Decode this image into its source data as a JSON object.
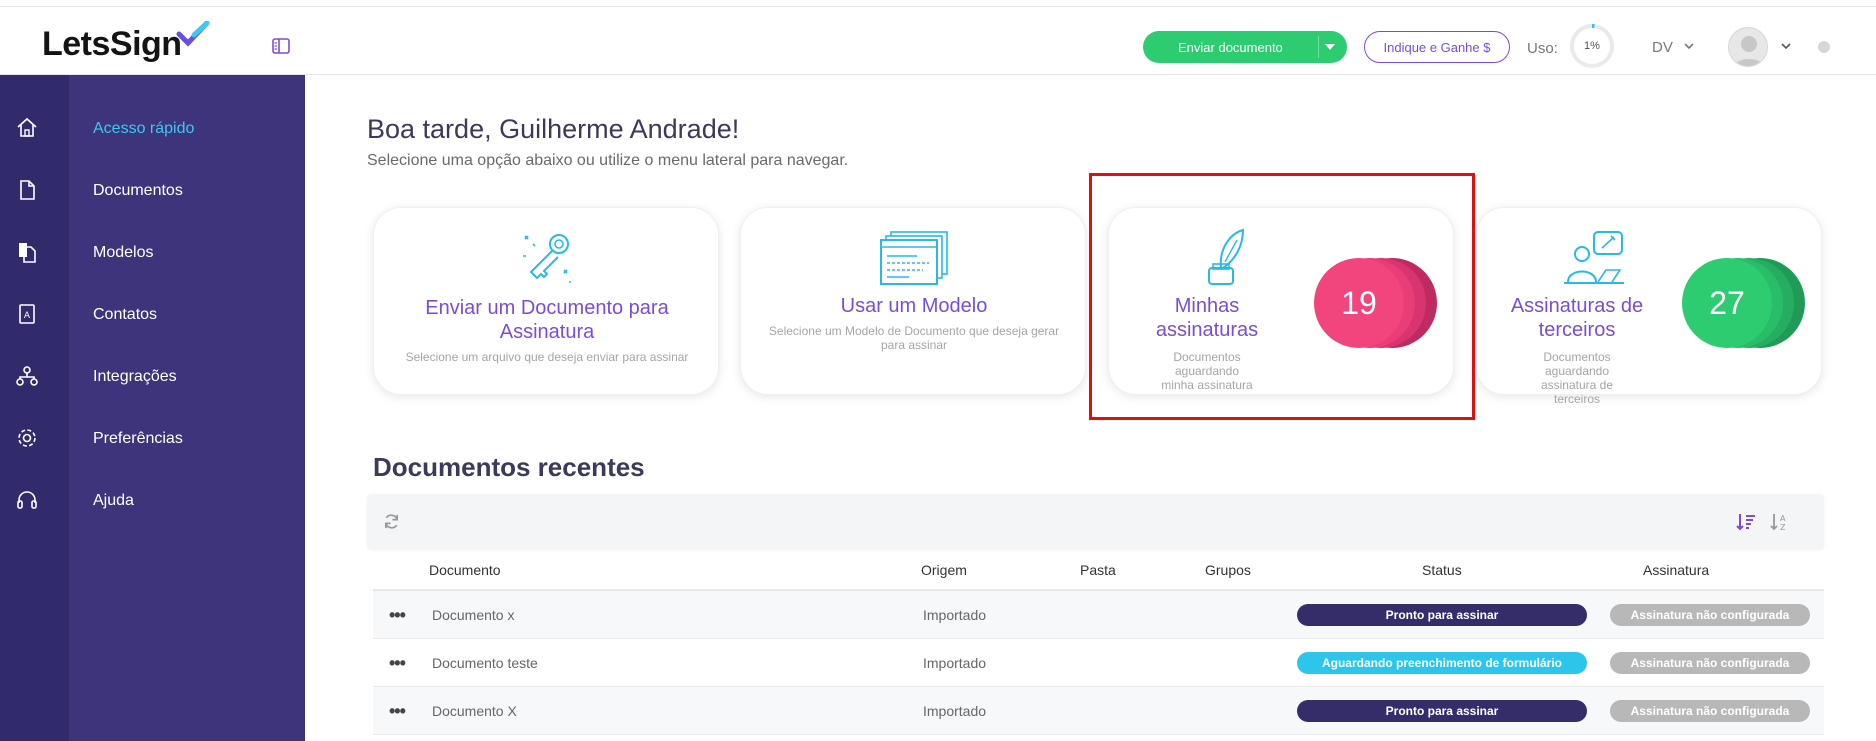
{
  "header": {
    "logo_text": "LetsSign",
    "send_button": "Enviar documento",
    "refer_button": "Indique e Ganhe $",
    "usage_label": "Uso:",
    "usage_value": "1%",
    "usage_fraction": 0.01,
    "org_initials": "DV"
  },
  "sidebar": {
    "items": [
      {
        "label": "Acesso rápido",
        "icon": "home-icon",
        "active": true
      },
      {
        "label": "Documentos",
        "icon": "document-icon"
      },
      {
        "label": "Modelos",
        "icon": "templates-icon"
      },
      {
        "label": "Contatos",
        "icon": "contacts-icon"
      },
      {
        "label": "Integrações",
        "icon": "integrations-icon"
      },
      {
        "label": "Preferências",
        "icon": "gear-icon"
      },
      {
        "label": "Ajuda",
        "icon": "headset-icon"
      }
    ]
  },
  "main": {
    "greeting": "Boa tarde, Guilherme Andrade!",
    "subtitle": "Selecione uma opção abaixo ou utilize o menu lateral para navegar.",
    "cards": [
      {
        "title": "Enviar um Documento para Assinatura",
        "desc": "Selecione um arquivo que deseja enviar para assinar",
        "icon": "pen-key-icon"
      },
      {
        "title": "Usar um Modelo",
        "desc": "Selecione um Modelo de Documento que deseja gerar para assinar",
        "icon": "template-windows-icon"
      },
      {
        "title": "Minhas assinaturas",
        "desc": "Documentos aguardando minha assinatura",
        "icon": "quill-ink-icon",
        "count": "19",
        "color": "#f2457e"
      },
      {
        "title": "Assinaturas de terceiros",
        "desc": "Documentos aguardando assinatura de terceiros",
        "icon": "person-signing-icon",
        "count": "27",
        "color": "#2ecc71"
      }
    ],
    "recent_title": "Documentos recentes",
    "table": {
      "headers": [
        "Documento",
        "Origem",
        "Pasta",
        "Grupos",
        "Status",
        "Assinatura"
      ],
      "rows": [
        {
          "name": "Documento x",
          "origin": "Importado",
          "status": "Pronto para assinar",
          "status_color": "#352d6a",
          "signature": "Assinatura não configurada"
        },
        {
          "name": "Documento teste",
          "origin": "Importado",
          "status": "Aguardando preenchimento de formulário",
          "status_color": "#2ec5ea",
          "signature": "Assinatura não configurada"
        },
        {
          "name": "Documento X",
          "origin": "Importado",
          "status": "Pronto para assinar",
          "status_color": "#352d6a",
          "signature": "Assinatura não configurada"
        }
      ]
    }
  },
  "colors": {
    "brand_purple": "#7b4dd6",
    "sidebar_dark": "#322b6b",
    "sidebar": "#3d347c",
    "active_link": "#3ec7f0",
    "green": "#2ecc71",
    "pink": "#f2457e",
    "icon_cyan": "#28b9e6",
    "highlight_red": "#e01010"
  }
}
